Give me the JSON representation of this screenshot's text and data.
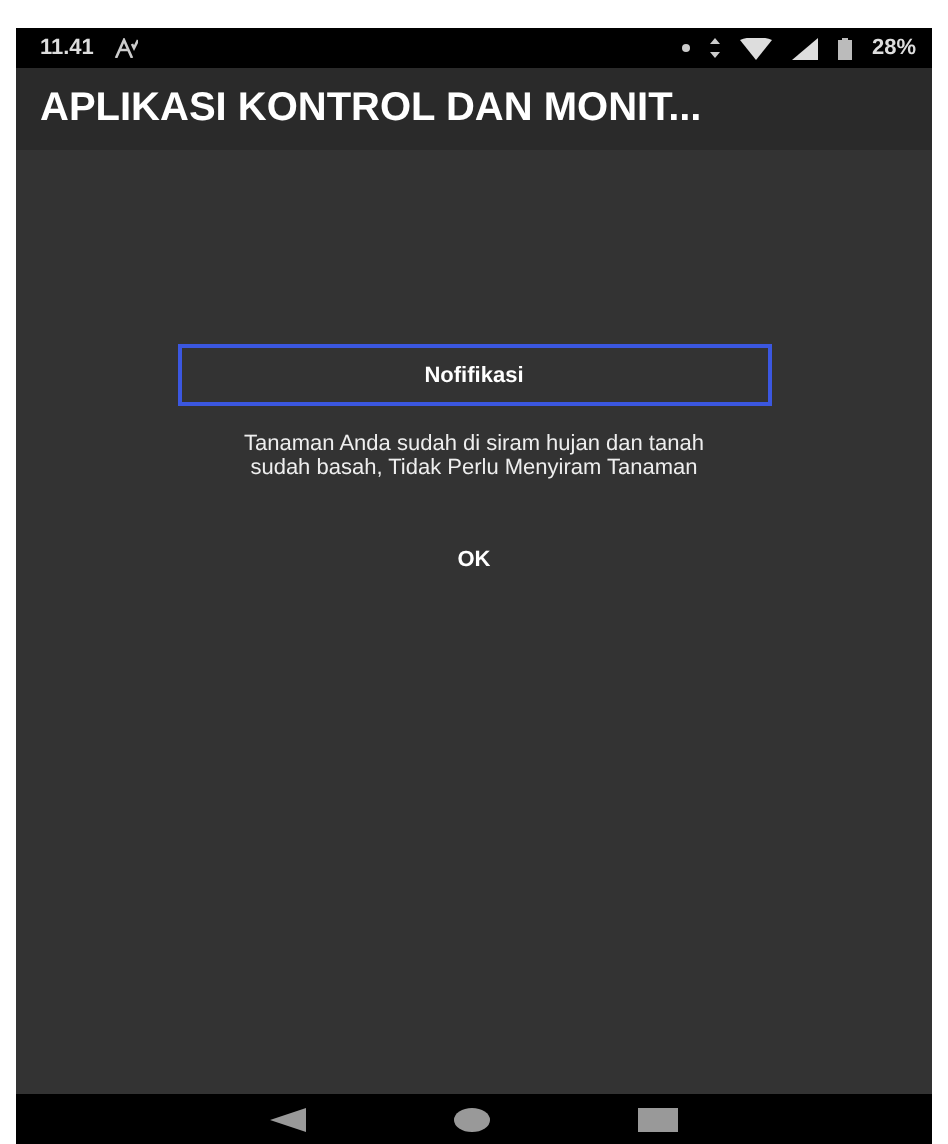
{
  "status_bar": {
    "time": "11.41",
    "battery": "28%"
  },
  "app_bar": {
    "title": "APLIKASI KONTROL DAN MONIT..."
  },
  "dialog": {
    "title": "Nofifikasi",
    "message": "Tanaman Anda sudah di siram hujan dan tanah sudah basah, Tidak Perlu Menyiram Tanaman",
    "buttons": [
      "OK"
    ]
  }
}
